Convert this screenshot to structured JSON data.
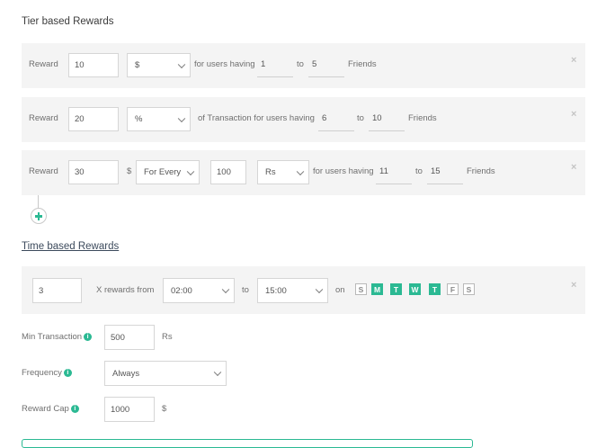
{
  "tier_section": {
    "title": "Tier based Rewards",
    "rows": [
      {
        "reward_label": "Reward",
        "reward_value": "10",
        "unit": "$",
        "text1": "for users having",
        "from": "1",
        "to_label": "to",
        "to": "5",
        "suffix": "Friends"
      },
      {
        "reward_label": "Reward",
        "reward_value": "20",
        "unit": "%",
        "text1": "of Transaction for users having",
        "from": "6",
        "to_label": "to",
        "to": "10",
        "suffix": "Friends"
      },
      {
        "reward_label": "Reward",
        "reward_value": "30",
        "currency": "$",
        "per": "For Every",
        "per_value": "100",
        "per_unit": "Rs",
        "text1": "for users having",
        "from": "11",
        "to_label": "to",
        "to": "15",
        "suffix": "Friends"
      }
    ],
    "close_glyph": "×"
  },
  "time_section": {
    "title": "Time based Rewards",
    "count": "3",
    "x_rewards_label": "X rewards from",
    "from_time": "02:00",
    "to_label": "to",
    "to_time": "15:00",
    "on_label": "on",
    "days": [
      {
        "label": "S",
        "active": false
      },
      {
        "label": "M",
        "active": true
      },
      {
        "label": "T",
        "active": true
      },
      {
        "label": "W",
        "active": true
      },
      {
        "label": "T",
        "active": true
      },
      {
        "label": "F",
        "active": false
      },
      {
        "label": "S",
        "active": false
      }
    ],
    "close_glyph": "×"
  },
  "settings": {
    "min_transaction": {
      "label": "Min Transaction",
      "value": "500",
      "unit": "Rs"
    },
    "frequency": {
      "label": "Frequency",
      "value": "Always"
    },
    "reward_cap": {
      "label": "Reward Cap",
      "value": "1000",
      "unit": "$"
    },
    "info_glyph": "i"
  },
  "colors": {
    "accent": "#2bb993",
    "row_bg": "#f4f4f4",
    "border": "#d6d6d6"
  }
}
